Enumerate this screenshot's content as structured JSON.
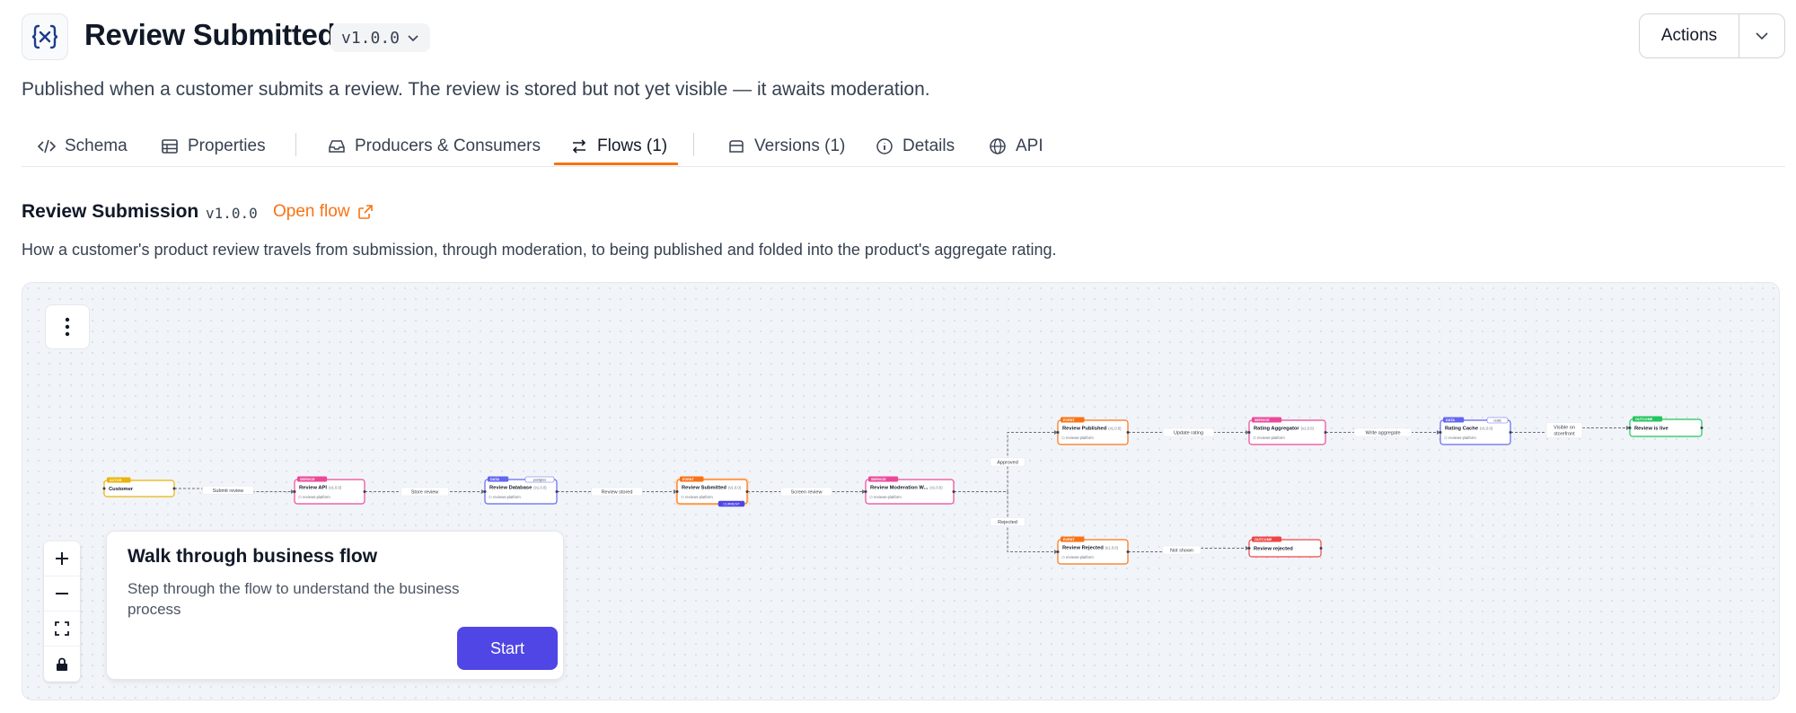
{
  "header": {
    "title": "Review Submitted",
    "version": "v1.0.0",
    "actions_label": "Actions",
    "description": "Published when a customer submits a review. The review is stored but not yet visible — it awaits moderation."
  },
  "tabs": [
    {
      "label": "Schema",
      "icon": "code-icon"
    },
    {
      "label": "Properties",
      "icon": "table-icon"
    },
    {
      "label": "Producers & Consumers",
      "icon": "inbox-icon"
    },
    {
      "label": "Flows (1)",
      "icon": "swap-icon",
      "active": true
    },
    {
      "label": "Versions (1)",
      "icon": "archive-icon"
    },
    {
      "label": "Details",
      "icon": "info-icon"
    },
    {
      "label": "API",
      "icon": "globe-icon"
    }
  ],
  "flow": {
    "name": "Review Submission",
    "version": "v1.0.0",
    "open_label": "Open flow",
    "description": "How a customer's product review travels from submission, through moderation, to being published and folded into the product's aggregate rating."
  },
  "graph": {
    "nodes": [
      {
        "id": "customer",
        "label": "Customer",
        "badge": "ACTOR",
        "color": "#eab308"
      },
      {
        "id": "review-api",
        "label": "Review API",
        "version": "(v1.0.0)",
        "badge": "SERVICE",
        "color": "#ec4899",
        "sub": "reviews-platform"
      },
      {
        "id": "review-db",
        "label": "Review Database",
        "version": "(v1.0.0)",
        "badge": "DATA",
        "color": "#6366f1",
        "sub": "reviews-platform",
        "tag": "postgres"
      },
      {
        "id": "review-submitted",
        "label": "Review Submitted",
        "version": "(v1.0.0)",
        "badge": "EVENT",
        "color": "#f97316",
        "sub": "reviews-platform",
        "tag": "CURRENT"
      },
      {
        "id": "review-moderation",
        "label": "Review Moderation W...",
        "version": "(v1.0.0)",
        "badge": "SERVICE",
        "color": "#ec4899",
        "sub": "reviews-platform"
      },
      {
        "id": "review-published",
        "label": "Review Published",
        "version": "(v1.0.0)",
        "badge": "EVENT",
        "color": "#f97316",
        "sub": "reviews-platform"
      },
      {
        "id": "rating-aggregator",
        "label": "Rating Aggregator",
        "version": "(v1.0.0)",
        "badge": "SERVICE",
        "color": "#ec4899",
        "sub": "reviews-platform"
      },
      {
        "id": "rating-cache",
        "label": "Rating Cache",
        "version": "(v1.0.0)",
        "badge": "DATA",
        "color": "#6366f1",
        "sub": "reviews-platform",
        "tag": "redis"
      },
      {
        "id": "review-live",
        "label": "Review is live",
        "badge": "OUTCOME",
        "color": "#22c55e"
      },
      {
        "id": "review-rejected-evt",
        "label": "Review Rejected",
        "version": "(v1.0.0)",
        "badge": "EVENT",
        "color": "#f97316",
        "sub": "reviews-platform"
      },
      {
        "id": "review-rejected",
        "label": "Review rejected",
        "badge": "OUTCOME",
        "color": "#ef4444"
      }
    ],
    "edges": [
      {
        "from": "customer",
        "to": "review-api",
        "label": "Submit review"
      },
      {
        "from": "review-api",
        "to": "review-db",
        "label": "Store review"
      },
      {
        "from": "review-db",
        "to": "review-submitted",
        "label": "Review stored"
      },
      {
        "from": "review-submitted",
        "to": "review-moderation",
        "label": "Screen review"
      },
      {
        "from": "review-moderation",
        "to": "review-published",
        "label": "Approved"
      },
      {
        "from": "review-moderation",
        "to": "review-rejected-evt",
        "label": "Rejected"
      },
      {
        "from": "review-published",
        "to": "rating-aggregator",
        "label": "Update rating"
      },
      {
        "from": "rating-aggregator",
        "to": "rating-cache",
        "label": "Write aggregate"
      },
      {
        "from": "rating-cache",
        "to": "review-live",
        "label": "Visible on storefront"
      },
      {
        "from": "review-rejected-evt",
        "to": "review-rejected",
        "label": "Not shown"
      }
    ]
  },
  "walkthrough": {
    "title": "Walk through business flow",
    "description": "Step through the flow to understand the business process",
    "start_label": "Start"
  },
  "controls": {
    "zoom_in": "zoom-in-icon",
    "zoom_out": "zoom-out-icon",
    "fit": "fit-view-icon",
    "lock": "lock-icon"
  }
}
